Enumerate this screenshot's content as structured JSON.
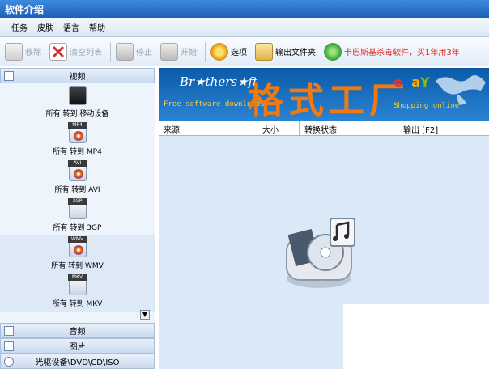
{
  "window": {
    "title": "软件介绍"
  },
  "menu": {
    "items": [
      "任务",
      "皮肤",
      "语言",
      "帮助"
    ]
  },
  "toolbar": {
    "remove": "移除",
    "clear_list": "清空列表",
    "stop": "停止",
    "start": "开始",
    "options": "选项",
    "output_folder": "输出文件夹",
    "promo": "卡巴斯基杀毒软件，买1年用3年"
  },
  "sidebar": {
    "video_header": "视频",
    "items": [
      {
        "label": "所有 转到 移动设备",
        "tag": ""
      },
      {
        "label": "所有 转到 MP4",
        "tag": "MP4"
      },
      {
        "label": "所有 转到 AVI",
        "tag": "AVI"
      },
      {
        "label": "所有 转到 3GP",
        "tag": "3GP"
      },
      {
        "label": "所有 转到 WMV",
        "tag": "WMV"
      },
      {
        "label": "所有 转到 MKV",
        "tag": "MKV"
      }
    ],
    "audio_header": "音频",
    "picture_header": "图片",
    "disc_header": "光驱设备\\DVD\\CD\\ISO"
  },
  "banner": {
    "brothersoft": "Br★thers★ft",
    "free_text": "Free software downloads",
    "big_text": "格式工厂",
    "ebay": [
      "e",
      "b",
      "a",
      "Y"
    ],
    "shopping": "Shopping online"
  },
  "grid": {
    "columns": [
      "来源",
      "大小",
      "转换状态",
      "输出 [F2]"
    ]
  },
  "colors": {
    "accent": "#1f5fb8",
    "banner_orange": "#f07a10",
    "promo_red": "#e0201c"
  }
}
